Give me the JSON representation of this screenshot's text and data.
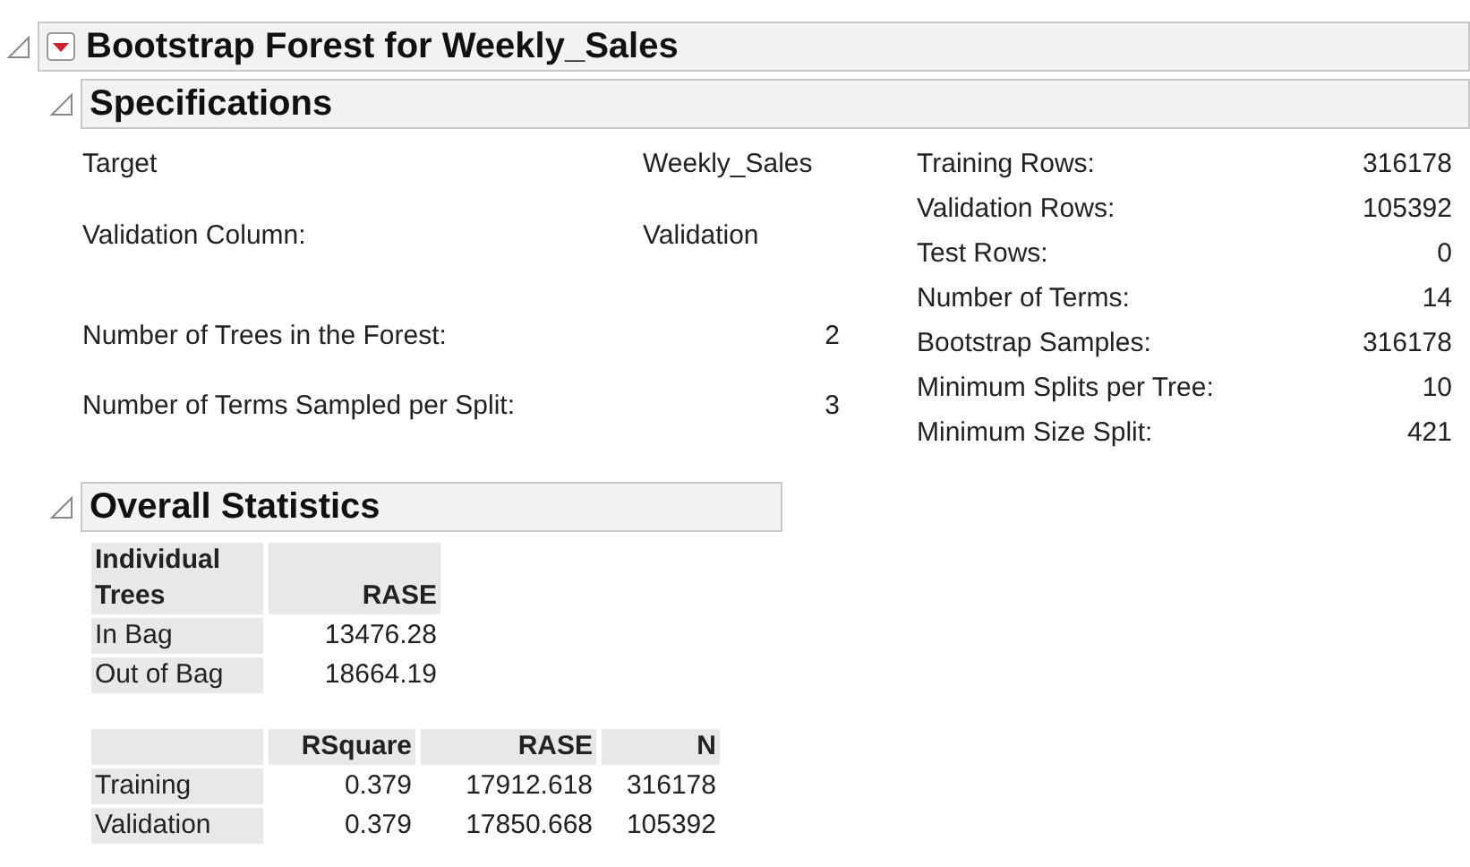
{
  "report": {
    "title": "Bootstrap Forest for Weekly_Sales",
    "expanded": true
  },
  "specifications": {
    "title": "Specifications",
    "expanded": true,
    "left_groups": [
      [
        {
          "label": "Target",
          "value": "Weekly_Sales",
          "kind": "text"
        },
        {
          "label": "Validation Column:",
          "value": "Validation",
          "kind": "text"
        }
      ],
      [
        {
          "label": "Number of Trees in the Forest:",
          "value": "2",
          "kind": "number"
        },
        {
          "label": "Number of Terms Sampled per Split:",
          "value": "3",
          "kind": "number"
        }
      ]
    ],
    "right": [
      {
        "label": "Training Rows:",
        "value": "316178"
      },
      {
        "label": "Validation Rows:",
        "value": "105392"
      },
      {
        "label": "Test Rows:",
        "value": "0"
      },
      {
        "label": "Number of Terms:",
        "value": "14"
      },
      {
        "label": "Bootstrap Samples:",
        "value": "316178"
      },
      {
        "label": "Minimum Splits per Tree:",
        "value": "10"
      },
      {
        "label": "Minimum Size Split:",
        "value": "421"
      }
    ]
  },
  "overall_statistics": {
    "title": "Overall Statistics",
    "expanded": true,
    "individual_trees": {
      "columns": [
        "Individual Trees",
        "RASE"
      ],
      "rows": [
        [
          "In Bag",
          "13476.28"
        ],
        [
          "Out of Bag",
          "18664.19"
        ]
      ]
    },
    "fit": {
      "columns": [
        "",
        "RSquare",
        "RASE",
        "N"
      ],
      "rows": [
        [
          "Training",
          "0.379",
          "17912.618",
          "316178"
        ],
        [
          "Validation",
          "0.379",
          "17850.668",
          "105392"
        ]
      ]
    }
  }
}
